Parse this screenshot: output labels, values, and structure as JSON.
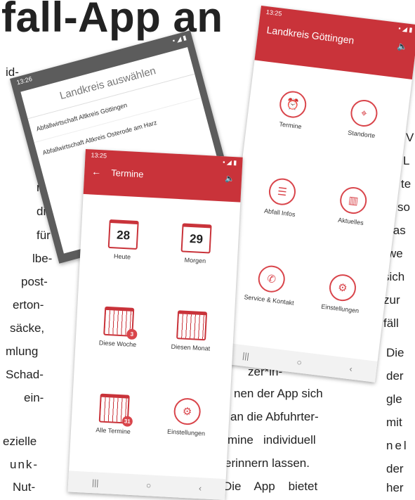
{
  "headline": "fall-App an",
  "left_column": [
    "id-",
    "n-",
    "die",
    "für",
    "lbe-",
    "post-",
    "erton-",
    "säcke,",
    "mlung",
    "Schad-",
    "ein-",
    "ezielle",
    "unk-",
    "Nut-"
  ],
  "middle_column": [
    "zer*in-",
    "nen der App sich",
    "an die Abfuhrter-",
    "mine   individuell",
    "erinnern lassen.",
    "Die    App    bietet"
  ],
  "right_column": [
    "V",
    "L",
    "te",
    "so",
    "las",
    "we",
    "sich",
    "zur",
    "fäll",
    "Die",
    "der",
    "gle",
    "mit",
    "nel",
    "der",
    "her"
  ],
  "phone_select": {
    "time": "13:26",
    "title": "Landkreis auswählen",
    "items": [
      "Abfallwirtschaft Altkreis Göttingen",
      "Abfallwirtschaft Altkreis Osterode am Harz"
    ]
  },
  "phone_termine": {
    "time": "13:25",
    "title": "Termine",
    "tiles": [
      {
        "label": "Heute",
        "day": "28"
      },
      {
        "label": "Morgen",
        "day": "29"
      },
      {
        "label": "Diese Woche",
        "badge": "3"
      },
      {
        "label": "Diesen Monat"
      },
      {
        "label": "Alle Termine",
        "badge": "31"
      },
      {
        "label": "Einstellungen"
      }
    ]
  },
  "phone_main": {
    "time": "13:25",
    "title": "Landkreis Göttingen",
    "tiles": [
      "Termine",
      "Standorte",
      "Abfall Infos",
      "Aktuelles",
      "Service & Kontakt",
      "Einstellungen"
    ]
  },
  "colors": {
    "accent": "#c9333a",
    "gray_header": "#575757"
  },
  "icons": [
    "alarm-clock-icon",
    "location-pin-icon",
    "list-icon",
    "book-icon",
    "phone-icon",
    "gear-icon",
    "calendar-icon",
    "speaker-icon",
    "back-arrow-icon"
  ]
}
